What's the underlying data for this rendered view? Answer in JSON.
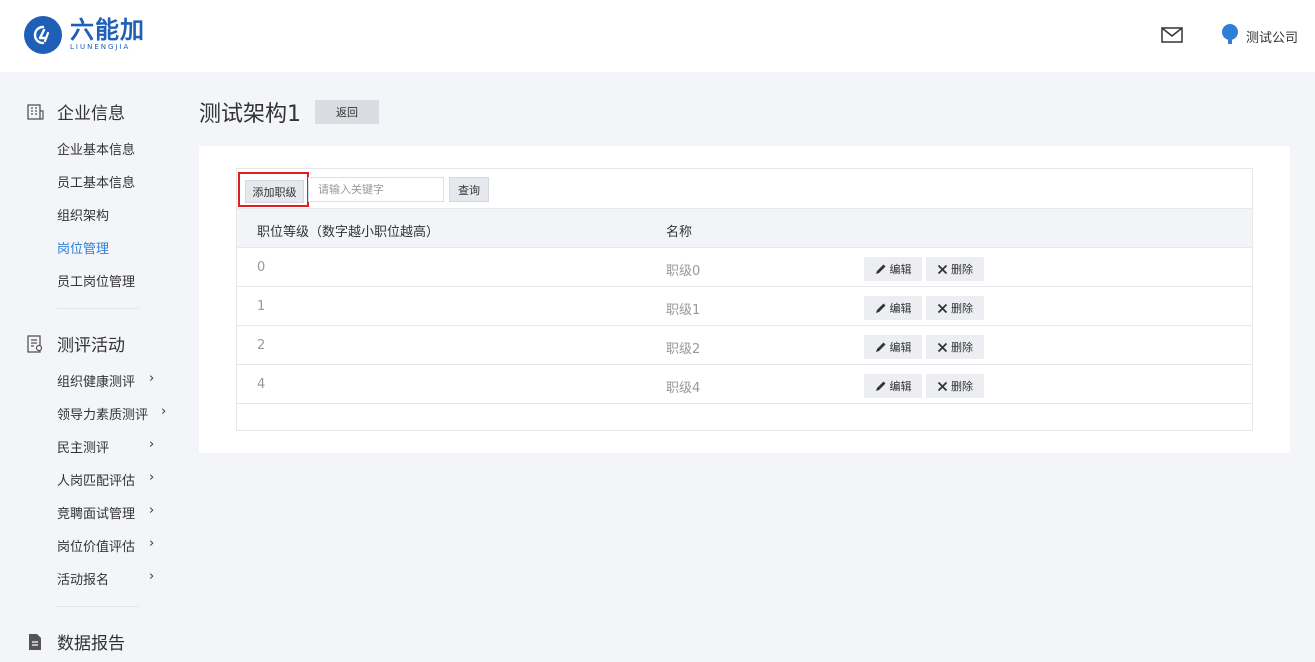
{
  "header": {
    "brand_cn": "六能加",
    "brand_en": "LIUNENGJIA",
    "company": "测试公司",
    "icons": [
      "mail-icon",
      "user-avatar-icon"
    ]
  },
  "sidebar": {
    "section_enterprise": "企业信息",
    "enterprise_items": [
      "企业基本信息",
      "员工基本信息",
      "组织架构",
      "岗位管理",
      "员工岗位管理"
    ],
    "active_item": "岗位管理",
    "section_evaluation": "测评活动",
    "evaluation_items": [
      "组织健康测评",
      "领导力素质测评",
      "民主测评",
      "人岗匹配评估",
      "竞聘面试管理",
      "岗位价值评估",
      "活动报名"
    ],
    "section_report": "数据报告",
    "chevron": "›"
  },
  "page": {
    "title": "测试架构1",
    "back_label": "返回"
  },
  "toolbar": {
    "add_label": "添加职级",
    "search_placeholder": "请输入关键字",
    "query_label": "查询"
  },
  "table": {
    "headers": [
      "职位等级（数字越小职位越高）",
      "名称"
    ],
    "rows": [
      {
        "level": "0",
        "name": "职级0"
      },
      {
        "level": "1",
        "name": "职级1"
      },
      {
        "level": "2",
        "name": "职级2"
      },
      {
        "level": "4",
        "name": "职级4"
      }
    ],
    "edit_label": "编辑",
    "delete_label": "删除"
  },
  "colors": {
    "brand": "#1f5fb8",
    "active": "#2d7fd8",
    "highlight_border": "#e02020"
  }
}
